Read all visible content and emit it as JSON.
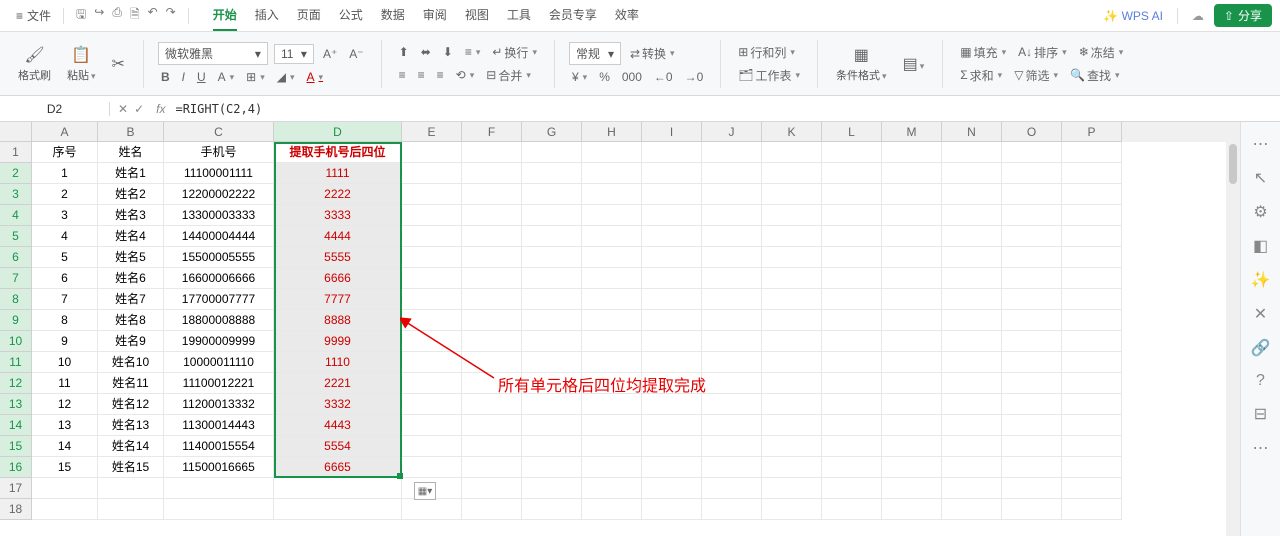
{
  "menubar": {
    "file": "文件",
    "tabs": [
      "开始",
      "插入",
      "页面",
      "公式",
      "数据",
      "审阅",
      "视图",
      "工具",
      "会员专享",
      "效率"
    ],
    "active_tab": 0,
    "wps_ai": "WPS AI",
    "share": "分享"
  },
  "ribbon": {
    "format_painter": "格式刷",
    "paste": "粘贴",
    "font_name": "微软雅黑",
    "font_size": "11",
    "bold": "B",
    "italic": "I",
    "underline": "U",
    "strike": "A",
    "wrap": "换行",
    "merge": "合并",
    "number_format": "常规",
    "convert": "转换",
    "rowcol": "行和列",
    "sheet": "工作表",
    "cond_format": "条件格式",
    "fill": "填充",
    "sum": "求和",
    "sort": "排序",
    "filter": "筛选",
    "freeze": "冻结",
    "find": "查找"
  },
  "formula_bar": {
    "name_box": "D2",
    "formula": "=RIGHT(C2,4)"
  },
  "columns": [
    "A",
    "B",
    "C",
    "D",
    "E",
    "F",
    "G",
    "H",
    "I",
    "J",
    "K",
    "L",
    "M",
    "N",
    "O",
    "P"
  ],
  "headers": {
    "A": "序号",
    "B": "姓名",
    "C": "手机号",
    "D": "提取手机号后四位"
  },
  "rows": [
    {
      "n": 1,
      "A": "1",
      "B": "姓名1",
      "C": "11100001111",
      "D": "1111"
    },
    {
      "n": 2,
      "A": "2",
      "B": "姓名2",
      "C": "12200002222",
      "D": "2222"
    },
    {
      "n": 3,
      "A": "3",
      "B": "姓名3",
      "C": "13300003333",
      "D": "3333"
    },
    {
      "n": 4,
      "A": "4",
      "B": "姓名4",
      "C": "14400004444",
      "D": "4444"
    },
    {
      "n": 5,
      "A": "5",
      "B": "姓名5",
      "C": "15500005555",
      "D": "5555"
    },
    {
      "n": 6,
      "A": "6",
      "B": "姓名6",
      "C": "16600006666",
      "D": "6666"
    },
    {
      "n": 7,
      "A": "7",
      "B": "姓名7",
      "C": "17700007777",
      "D": "7777"
    },
    {
      "n": 8,
      "A": "8",
      "B": "姓名8",
      "C": "18800008888",
      "D": "8888"
    },
    {
      "n": 9,
      "A": "9",
      "B": "姓名9",
      "C": "19900009999",
      "D": "9999"
    },
    {
      "n": 10,
      "A": "10",
      "B": "姓名10",
      "C": "10000011110",
      "D": "1110"
    },
    {
      "n": 11,
      "A": "11",
      "B": "姓名11",
      "C": "11100012221",
      "D": "2221"
    },
    {
      "n": 12,
      "A": "12",
      "B": "姓名12",
      "C": "11200013332",
      "D": "3332"
    },
    {
      "n": 13,
      "A": "13",
      "B": "姓名13",
      "C": "11300014443",
      "D": "4443"
    },
    {
      "n": 14,
      "A": "14",
      "B": "姓名14",
      "C": "11400015554",
      "D": "5554"
    },
    {
      "n": 15,
      "A": "15",
      "B": "姓名15",
      "C": "11500016665",
      "D": "6665"
    }
  ],
  "annotation_text": "所有单元格后四位均提取完成"
}
